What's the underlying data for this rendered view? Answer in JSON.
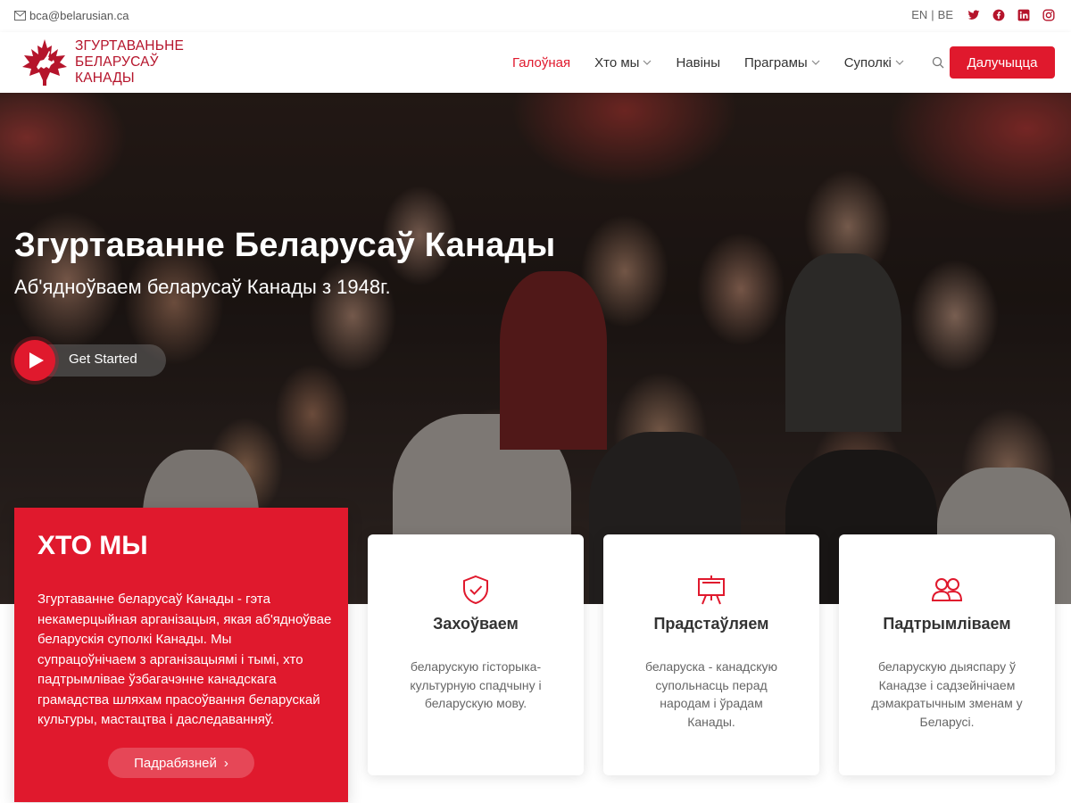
{
  "topbar": {
    "email": "bca@belarusian.ca",
    "lang_en": "EN",
    "lang_sep": "|",
    "lang_be": "BE",
    "social": [
      "twitter-icon",
      "facebook-icon",
      "linkedin-icon",
      "instagram-icon"
    ]
  },
  "brand": {
    "line1": "ЗГУРТАВАНЬНЕ",
    "line2": "БЕЛАРУСАЎ",
    "line3": "КАНАДЫ",
    "color": "#b5142b"
  },
  "nav": {
    "items": [
      {
        "label": "Галоўная",
        "active": true,
        "dropdown": false
      },
      {
        "label": "Хто мы",
        "active": false,
        "dropdown": true
      },
      {
        "label": "Навіны",
        "active": false,
        "dropdown": false
      },
      {
        "label": "Праграмы",
        "active": false,
        "dropdown": true
      },
      {
        "label": "Суполкі",
        "active": false,
        "dropdown": true
      }
    ],
    "join_label": "Далучыцца",
    "accent": "#e0192d"
  },
  "hero": {
    "title": "Згуртаванне Беларусаў Канады",
    "subtitle": "Аб'ядноўваем беларусаў Канады з 1948г.",
    "cta_label": "Get Started"
  },
  "who": {
    "heading": "ХТО МЫ",
    "text": "Згуртаванне беларусаў Канады - гэта некамерцыйная арганізацыя, якая аб'ядноўвае беларускія суполкі Канады. Мы супрацоўнічаем з арганізацыямі і тымі, хто падтрымлівае ўзбагачэнне канадскага грамадства шляхам прасоўвання беларускай культуры, мастацтва і даследаванняў.",
    "button_label": "Падрабязней",
    "button_arrow": "›"
  },
  "features": [
    {
      "icon": "shield-check-icon",
      "title": "Захоўваем",
      "text": "беларускую гісторыка-культурную спадчыну і беларускую мову."
    },
    {
      "icon": "presentation-easel-icon",
      "title": "Прадстаўляем",
      "text": "беларуска - канадскую супольнасць перад народам і ўрадам Канады."
    },
    {
      "icon": "people-icon",
      "title": "Падтрымліваем",
      "text": "беларускую дыяспару ў Канадзе і садзейнічаем дэмакратычным зменам у Беларусі."
    }
  ]
}
